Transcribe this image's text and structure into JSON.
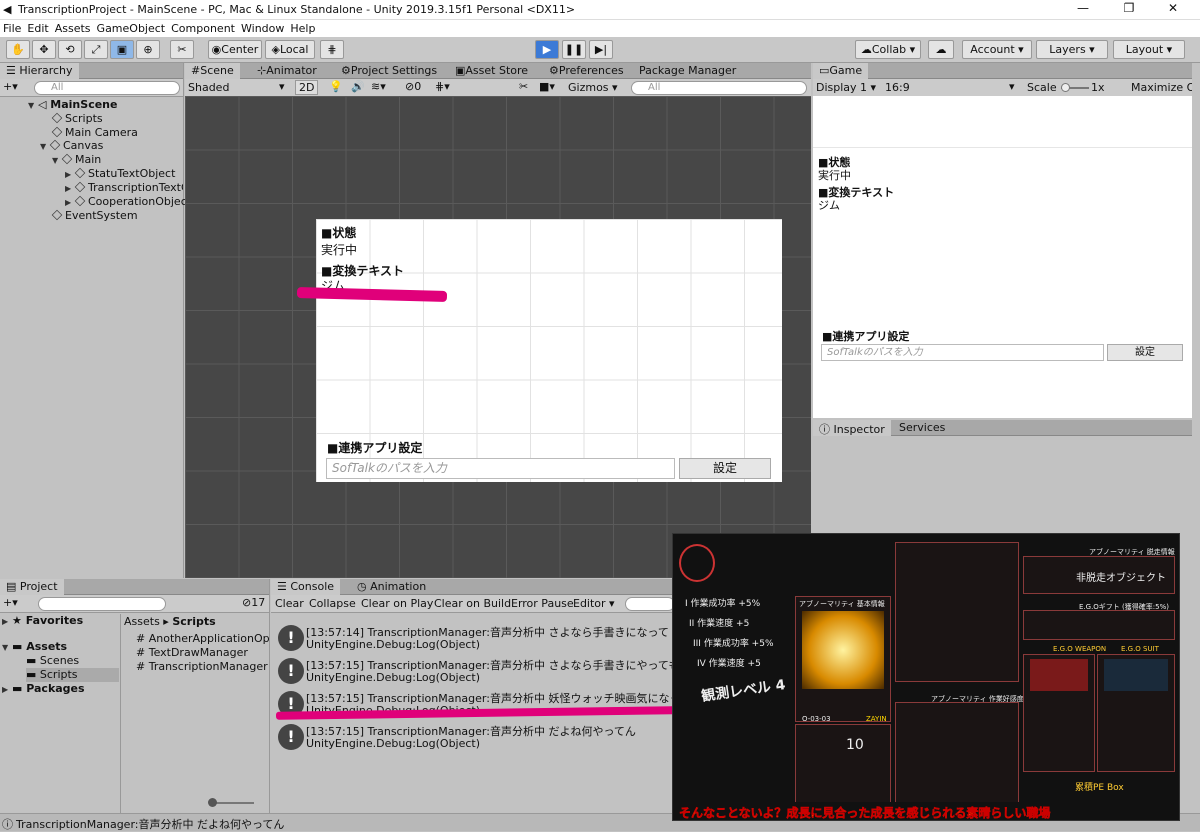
{
  "window": {
    "title": "TranscriptionProject - MainScene - PC, Mac & Linux Standalone - Unity 2019.3.15f1 Personal <DX11>"
  },
  "menu": [
    "File",
    "Edit",
    "Assets",
    "GameObject",
    "Component",
    "Window",
    "Help"
  ],
  "toolbar": {
    "center": "Center",
    "local": "Local",
    "collab": "Collab",
    "account": "Account",
    "layers": "Layers",
    "layout": "Layout"
  },
  "hierarchy": {
    "tab": "Hierarchy",
    "search": "All",
    "scene": "MainScene",
    "items": [
      "Scripts",
      "Main Camera",
      "Canvas",
      "Main",
      "StatuTextObject",
      "TranscriptionTextObject",
      "CooperationObject",
      "EventSystem"
    ]
  },
  "scene_tabs": [
    "Scene",
    "Animator",
    "Project Settings",
    "Asset Store",
    "Preferences",
    "Package Manager"
  ],
  "scene_toolbar": {
    "shading": "Shaded",
    "mode2d": "2D",
    "gizmos": "Gizmos",
    "search": "All",
    "count": "0"
  },
  "canvas": {
    "status_label": "■状態",
    "status_value": "実行中",
    "transform_label": "■変換テキスト",
    "transform_value": "ジム",
    "app_label": "■連携アプリ設定",
    "path_placeholder": "SofTalkのパスを入力",
    "set_button": "設定"
  },
  "game": {
    "tab": "Game",
    "display": "Display 1",
    "aspect": "16:9",
    "scale_label": "Scale",
    "scale_value": "1x",
    "maximize": "Maximize On Play"
  },
  "inspector": {
    "tab": "Inspector",
    "services": "Services"
  },
  "project": {
    "tab": "Project",
    "favorites": "Favorites",
    "assets": "Assets",
    "scenes": "Scenes",
    "scripts": "Scripts",
    "packages": "Packages",
    "breadcrumb_root": "Assets",
    "breadcrumb_current": "Scripts",
    "files": [
      "AnotherApplicationOperator",
      "TextDrawManager",
      "TranscriptionManager"
    ],
    "count": "17"
  },
  "console": {
    "tab": "Console",
    "anim_tab": "Animation",
    "buttons": [
      "Clear",
      "Collapse",
      "Clear on Play",
      "Clear on Build",
      "Error Pause",
      "Editor"
    ],
    "messages": [
      {
        "line1": "[13:57:14] TranscriptionManager:音声分析中 さよなら手書きになって",
        "line2": "UnityEngine.Debug:Log(Object)"
      },
      {
        "line1": "[13:57:15] TranscriptionManager:音声分析中 さよなら手書きにやっても",
        "line2": "UnityEngine.Debug:Log(Object)"
      },
      {
        "line1": "[13:57:15] TranscriptionManager:音声分析中 妖怪ウォッチ映画気になってる",
        "line2": "UnityEngine.Debug:Log(Object)"
      },
      {
        "line1": "[13:57:15] TranscriptionManager:音声分析中 だよね何やってん",
        "line2": "UnityEngine.Debug:Log(Object)"
      }
    ]
  },
  "status_bar": "TranscriptionManager:音声分析中 だよね何やってん",
  "game_overlay": {
    "list": [
      "I 作業成功率 +5%",
      "II 作業速度 +5",
      "III 作業成功率 +5%",
      "IV 作業速度 +5"
    ],
    "level": "観測レベル 4",
    "title1": "アブノーマリティ 基本情報",
    "title2": "アブノーマリティ 作業好感度",
    "title3": "アブノーマリティ 脱走情報",
    "escape": "非脱走オブジェクト",
    "ego_weapon": "E.G.O WEAPON",
    "ego_suit": "E.G.O SUIT",
    "ego_gift": "E.G.Oギフト (獲得確率:5%)",
    "pe_box": "累積PE Box",
    "pe_value": "10",
    "zayin": "ZAYIN",
    "code": "O-03-03",
    "caption": "そんなことないよ？成長に見合った成長を感じられる素晴らしい職場"
  },
  "colors": {
    "accent": "#e0007a",
    "play": "#3c7ad6"
  }
}
